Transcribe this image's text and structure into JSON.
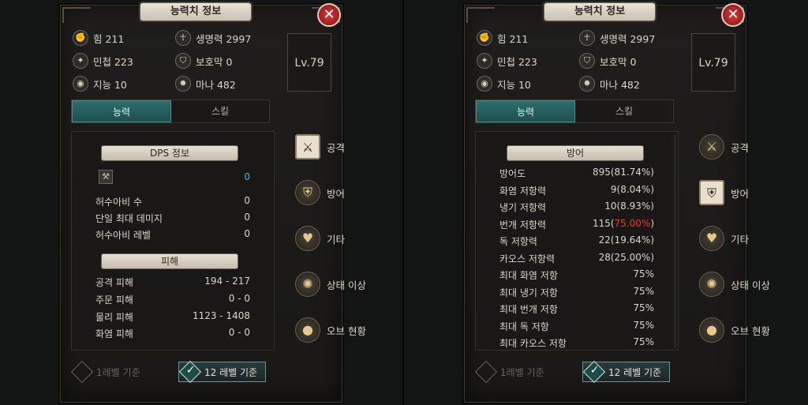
{
  "colors": {
    "teal_tab": "#2e6d6e",
    "plate": "#e6e0d2",
    "highlight_red": "#e0413a",
    "highlight_cyan": "#4ab8d8"
  },
  "left": {
    "title": "능력치 정보",
    "stats": [
      {
        "icon": "strength-icon",
        "glyph": "✊",
        "label": "힘 211"
      },
      {
        "icon": "agility-icon",
        "glyph": "✦",
        "label": "민첩 223"
      },
      {
        "icon": "intelligence-icon",
        "glyph": "◉",
        "label": "지능 10"
      },
      {
        "icon": "life-icon",
        "glyph": "☥",
        "label": "생명력 2997"
      },
      {
        "icon": "shield-icon",
        "glyph": "⛉",
        "label": "보호막 0"
      },
      {
        "icon": "mana-icon",
        "glyph": "✹",
        "label": "마나 482"
      }
    ],
    "level": "Lv.79",
    "tabs": [
      "능력",
      "스킬"
    ],
    "dps_title": "DPS 정보",
    "dps_value": "0",
    "dps_rows": [
      {
        "label": "허수아비 수",
        "value": "0"
      },
      {
        "label": "단일 최대 데미지",
        "value": "0"
      },
      {
        "label": "허수아비 레벨",
        "value": "0"
      }
    ],
    "damage_title": "피해",
    "damage_rows": [
      {
        "label": "공격 피해",
        "value": "194 - 217"
      },
      {
        "label": "주문 피해",
        "value": "0 - 0"
      },
      {
        "label": "물리 피해",
        "value": "1123 - 1408"
      },
      {
        "label": "화염 피해",
        "value": "0 - 0"
      }
    ],
    "categories": [
      {
        "icon": "attack-icon",
        "glyph": "⚔",
        "label": "공격"
      },
      {
        "icon": "defense-icon",
        "glyph": "⛨",
        "label": "방어"
      },
      {
        "icon": "heart-icon",
        "glyph": "♥",
        "label": "기타"
      },
      {
        "icon": "status-ailment-icon",
        "glyph": "✺",
        "label": "상태 이상"
      },
      {
        "icon": "orb-icon",
        "glyph": "●",
        "label": "오브 현황"
      }
    ],
    "btn_level1": "1레벨 기준",
    "btn_level12": "12 레벨 기준"
  },
  "right": {
    "title": "능력치 정보",
    "level": "Lv.79",
    "tabs": [
      "능력",
      "스킬"
    ],
    "defense_title": "방어",
    "defense_rows": [
      {
        "label": "방어도",
        "value": "895(81.74%)"
      },
      {
        "label": "화염 저항력",
        "value": "9(8.04%)"
      },
      {
        "label": "냉기 저항력",
        "value": "10(8.93%)"
      },
      {
        "label": "번개 저항력",
        "value_pre": "115(",
        "value_red": "75.00%",
        "value_post": ")"
      },
      {
        "label": "독 저항력",
        "value": "22(19.64%)"
      },
      {
        "label": "카오스 저항력",
        "value": "28(25.00%)"
      },
      {
        "label": "최대 화염 저항",
        "value": "75%"
      },
      {
        "label": "최대 냉기 저항",
        "value": "75%"
      },
      {
        "label": "최대 번개 저항",
        "value": "75%"
      },
      {
        "label": "최대 독 저항",
        "value": "75%"
      },
      {
        "label": "최대 카오스 저항",
        "value": "75%"
      }
    ],
    "btn_level1": "1레벨 기준",
    "btn_level12": "12 레벨 기준"
  }
}
